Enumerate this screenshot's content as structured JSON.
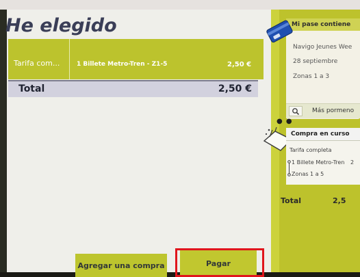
{
  "page_title": "He elegido",
  "cart": {
    "tarifa_label": "Tarifa com...",
    "item_label": "1 Billete Metro-Tren - Z1-5",
    "item_price": "2,50 €",
    "total_label": "Total",
    "total_amount": "2,50 €"
  },
  "buttons": {
    "add_purchase": "Agregar una compra",
    "pay": "Pagar"
  },
  "pass_card": {
    "heading": "Mi pase contiene",
    "line1": "Navigo Jeunes Wee",
    "line2": "28 septiembre",
    "line3": "Zonas 1 a 3",
    "more_label": "Más pormeno"
  },
  "purchase_in_progress": {
    "heading": "Compra en curso",
    "fare": "Tarifa completa",
    "ticket": "1 Billete Metro-Tren",
    "ticket_suffix": "2",
    "zones": "Zonas 1 a 5"
  },
  "side_total": {
    "label": "Total",
    "amount": "2,5"
  },
  "icons": {
    "pass": "card-icon",
    "cart": "basket-icon",
    "search": "search-icon"
  },
  "colors": {
    "accent": "#bdc22c",
    "highlight": "#e0151c"
  }
}
